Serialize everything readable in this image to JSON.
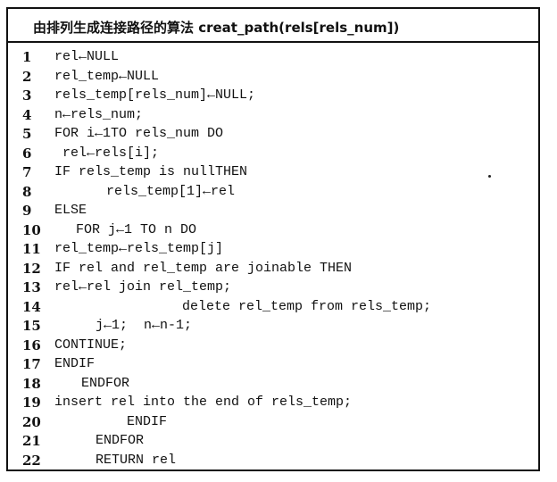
{
  "title": "由排列生成连接路径的算法 creat_path(rels[rels_num])",
  "lines": [
    {
      "number": "1",
      "code": "rel←NULL"
    },
    {
      "number": "2",
      "code": "rel_temp←NULL"
    },
    {
      "number": "3",
      "code": "rels_temp[rels_num]←NULL;"
    },
    {
      "number": "4",
      "code": "n←rels_num;"
    },
    {
      "number": "5",
      "code": "FOR i←1TO rels_num DO"
    },
    {
      "number": "6",
      "code": "rel←rels[i];"
    },
    {
      "number": "7",
      "code": "IF rels_temp is nullTHEN"
    },
    {
      "number": "8",
      "code": "rels_temp[1]←rel"
    },
    {
      "number": "9",
      "code": "ELSE"
    },
    {
      "number": "10",
      "code": "FOR j←1 TO n DO"
    },
    {
      "number": "11",
      "code": "rel_temp←rels_temp[j]"
    },
    {
      "number": "12",
      "code": "IF rel and rel_temp are joinable THEN"
    },
    {
      "number": "13",
      "code": "rel←rel join rel_temp;"
    },
    {
      "number": "14",
      "code": "delete rel_temp from rels_temp;"
    },
    {
      "number": "15",
      "code": "j←1;  n←n-1;"
    },
    {
      "number": "16",
      "code": "CONTINUE;"
    },
    {
      "number": "17",
      "code": "ENDIF"
    },
    {
      "number": "18",
      "code": "ENDFOR"
    },
    {
      "number": "19",
      "code": "insert rel into the end of rels_temp;"
    },
    {
      "number": "20",
      "code": "ENDIF"
    },
    {
      "number": "21",
      "code": "ENDFOR"
    },
    {
      "number": "22",
      "code": "RETURN rel"
    }
  ]
}
